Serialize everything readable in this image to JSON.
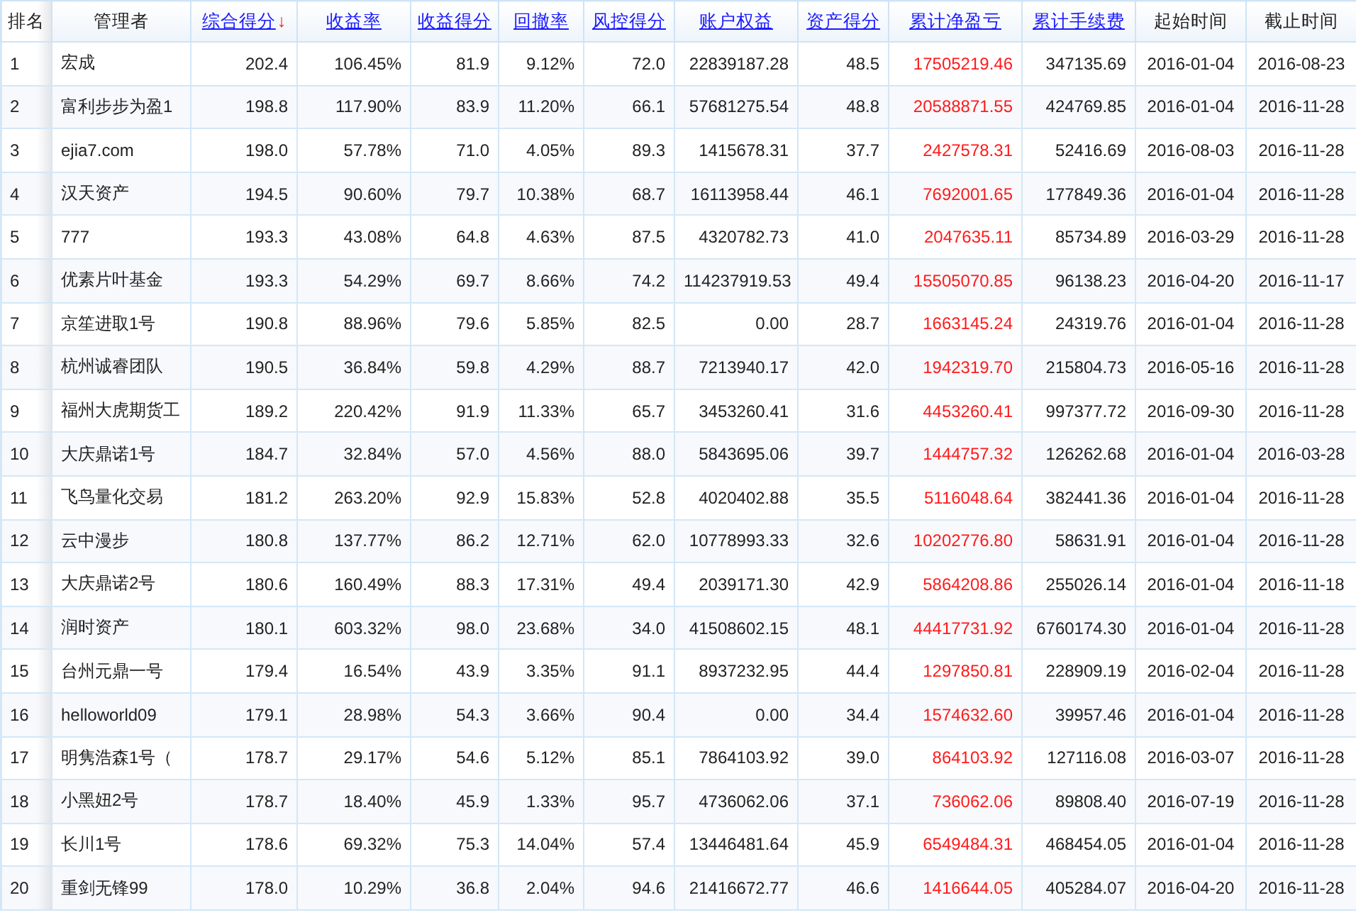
{
  "table": {
    "sort_arrow": "↓",
    "columns": [
      {
        "label": "排名",
        "kind": "label",
        "emphasis": false
      },
      {
        "label": "管理者",
        "kind": "label",
        "emphasis": false
      },
      {
        "label": "综合得分",
        "kind": "sort_link",
        "sorted": true,
        "emphasis": false
      },
      {
        "label": "收益率",
        "kind": "sort_link",
        "sorted": false,
        "emphasis": false
      },
      {
        "label": "收益得分",
        "kind": "sort_link",
        "sorted": false,
        "emphasis": false
      },
      {
        "label": "回撤率",
        "kind": "sort_link",
        "sorted": false,
        "emphasis": false
      },
      {
        "label": "风控得分",
        "kind": "sort_link",
        "sorted": false,
        "emphasis": false
      },
      {
        "label": "账户权益",
        "kind": "sort_link",
        "sorted": false,
        "emphasis": false
      },
      {
        "label": "资产得分",
        "kind": "sort_link",
        "sorted": false,
        "emphasis": false
      },
      {
        "label": "累计净盈亏",
        "kind": "sort_link",
        "sorted": false,
        "emphasis": true
      },
      {
        "label": "累计手续费",
        "kind": "sort_link",
        "sorted": false,
        "emphasis": false
      },
      {
        "label": "起始时间",
        "kind": "label",
        "emphasis": false
      },
      {
        "label": "截止时间",
        "kind": "label",
        "emphasis": false
      }
    ],
    "rows": [
      [
        "1",
        "宏成",
        "202.4",
        "106.45%",
        "81.9",
        "9.12%",
        "72.0",
        "22839187.28",
        "48.5",
        "17505219.46",
        "347135.69",
        "2016-01-04",
        "2016-08-23"
      ],
      [
        "2",
        "富利步步为盈1",
        "198.8",
        "117.90%",
        "83.9",
        "11.20%",
        "66.1",
        "57681275.54",
        "48.8",
        "20588871.55",
        "424769.85",
        "2016-01-04",
        "2016-11-28"
      ],
      [
        "3",
        "ejia7.com",
        "198.0",
        "57.78%",
        "71.0",
        "4.05%",
        "89.3",
        "1415678.31",
        "37.7",
        "2427578.31",
        "52416.69",
        "2016-08-03",
        "2016-11-28"
      ],
      [
        "4",
        "汉天资产",
        "194.5",
        "90.60%",
        "79.7",
        "10.38%",
        "68.7",
        "16113958.44",
        "46.1",
        "7692001.65",
        "177849.36",
        "2016-01-04",
        "2016-11-28"
      ],
      [
        "5",
        "777",
        "193.3",
        "43.08%",
        "64.8",
        "4.63%",
        "87.5",
        "4320782.73",
        "41.0",
        "2047635.11",
        "85734.89",
        "2016-03-29",
        "2016-11-28"
      ],
      [
        "6",
        "优素片叶基金",
        "193.3",
        "54.29%",
        "69.7",
        "8.66%",
        "74.2",
        "114237919.53",
        "49.4",
        "15505070.85",
        "96138.23",
        "2016-04-20",
        "2016-11-17"
      ],
      [
        "7",
        "京笙进取1号",
        "190.8",
        "88.96%",
        "79.6",
        "5.85%",
        "82.5",
        "0.00",
        "28.7",
        "1663145.24",
        "24319.76",
        "2016-01-04",
        "2016-11-28"
      ],
      [
        "8",
        "杭州诚睿团队",
        "190.5",
        "36.84%",
        "59.8",
        "4.29%",
        "88.7",
        "7213940.17",
        "42.0",
        "1942319.70",
        "215804.73",
        "2016-05-16",
        "2016-11-28"
      ],
      [
        "9",
        "福州大虎期货工",
        "189.2",
        "220.42%",
        "91.9",
        "11.33%",
        "65.7",
        "3453260.41",
        "31.6",
        "4453260.41",
        "997377.72",
        "2016-09-30",
        "2016-11-28"
      ],
      [
        "10",
        "大庆鼎诺1号",
        "184.7",
        "32.84%",
        "57.0",
        "4.56%",
        "88.0",
        "5843695.06",
        "39.7",
        "1444757.32",
        "126262.68",
        "2016-01-04",
        "2016-03-28"
      ],
      [
        "11",
        "飞鸟量化交易",
        "181.2",
        "263.20%",
        "92.9",
        "15.83%",
        "52.8",
        "4020402.88",
        "35.5",
        "5116048.64",
        "382441.36",
        "2016-01-04",
        "2016-11-28"
      ],
      [
        "12",
        "云中漫步",
        "180.8",
        "137.77%",
        "86.2",
        "12.71%",
        "62.0",
        "10778993.33",
        "32.6",
        "10202776.80",
        "58631.91",
        "2016-01-04",
        "2016-11-28"
      ],
      [
        "13",
        "大庆鼎诺2号",
        "180.6",
        "160.49%",
        "88.3",
        "17.31%",
        "49.4",
        "2039171.30",
        "42.9",
        "5864208.86",
        "255026.14",
        "2016-01-04",
        "2016-11-18"
      ],
      [
        "14",
        "润时资产",
        "180.1",
        "603.32%",
        "98.0",
        "23.68%",
        "34.0",
        "41508602.15",
        "48.1",
        "44417731.92",
        "6760174.30",
        "2016-01-04",
        "2016-11-28"
      ],
      [
        "15",
        "台州元鼎一号",
        "179.4",
        "16.54%",
        "43.9",
        "3.35%",
        "91.1",
        "8937232.95",
        "44.4",
        "1297850.81",
        "228909.19",
        "2016-02-04",
        "2016-11-28"
      ],
      [
        "16",
        "helloworld09",
        "179.1",
        "28.98%",
        "54.3",
        "3.66%",
        "90.4",
        "0.00",
        "34.4",
        "1574632.60",
        "39957.46",
        "2016-01-04",
        "2016-11-28"
      ],
      [
        "17",
        "明隽浩森1号（",
        "178.7",
        "29.17%",
        "54.6",
        "5.12%",
        "85.1",
        "7864103.92",
        "39.0",
        "864103.92",
        "127116.08",
        "2016-03-07",
        "2016-11-28"
      ],
      [
        "18",
        "小黑妞2号",
        "178.7",
        "18.40%",
        "45.9",
        "1.33%",
        "95.7",
        "4736062.06",
        "37.1",
        "736062.06",
        "89808.40",
        "2016-07-19",
        "2016-11-28"
      ],
      [
        "19",
        "长川1号",
        "178.6",
        "69.32%",
        "75.3",
        "14.04%",
        "57.4",
        "13446481.64",
        "45.9",
        "6549484.31",
        "468454.05",
        "2016-01-04",
        "2016-11-28"
      ],
      [
        "20",
        "重剑无锋99",
        "178.0",
        "10.29%",
        "36.8",
        "2.04%",
        "94.6",
        "21416672.77",
        "46.6",
        "1416644.05",
        "405284.07",
        "2016-04-20",
        "2016-11-28"
      ]
    ]
  }
}
